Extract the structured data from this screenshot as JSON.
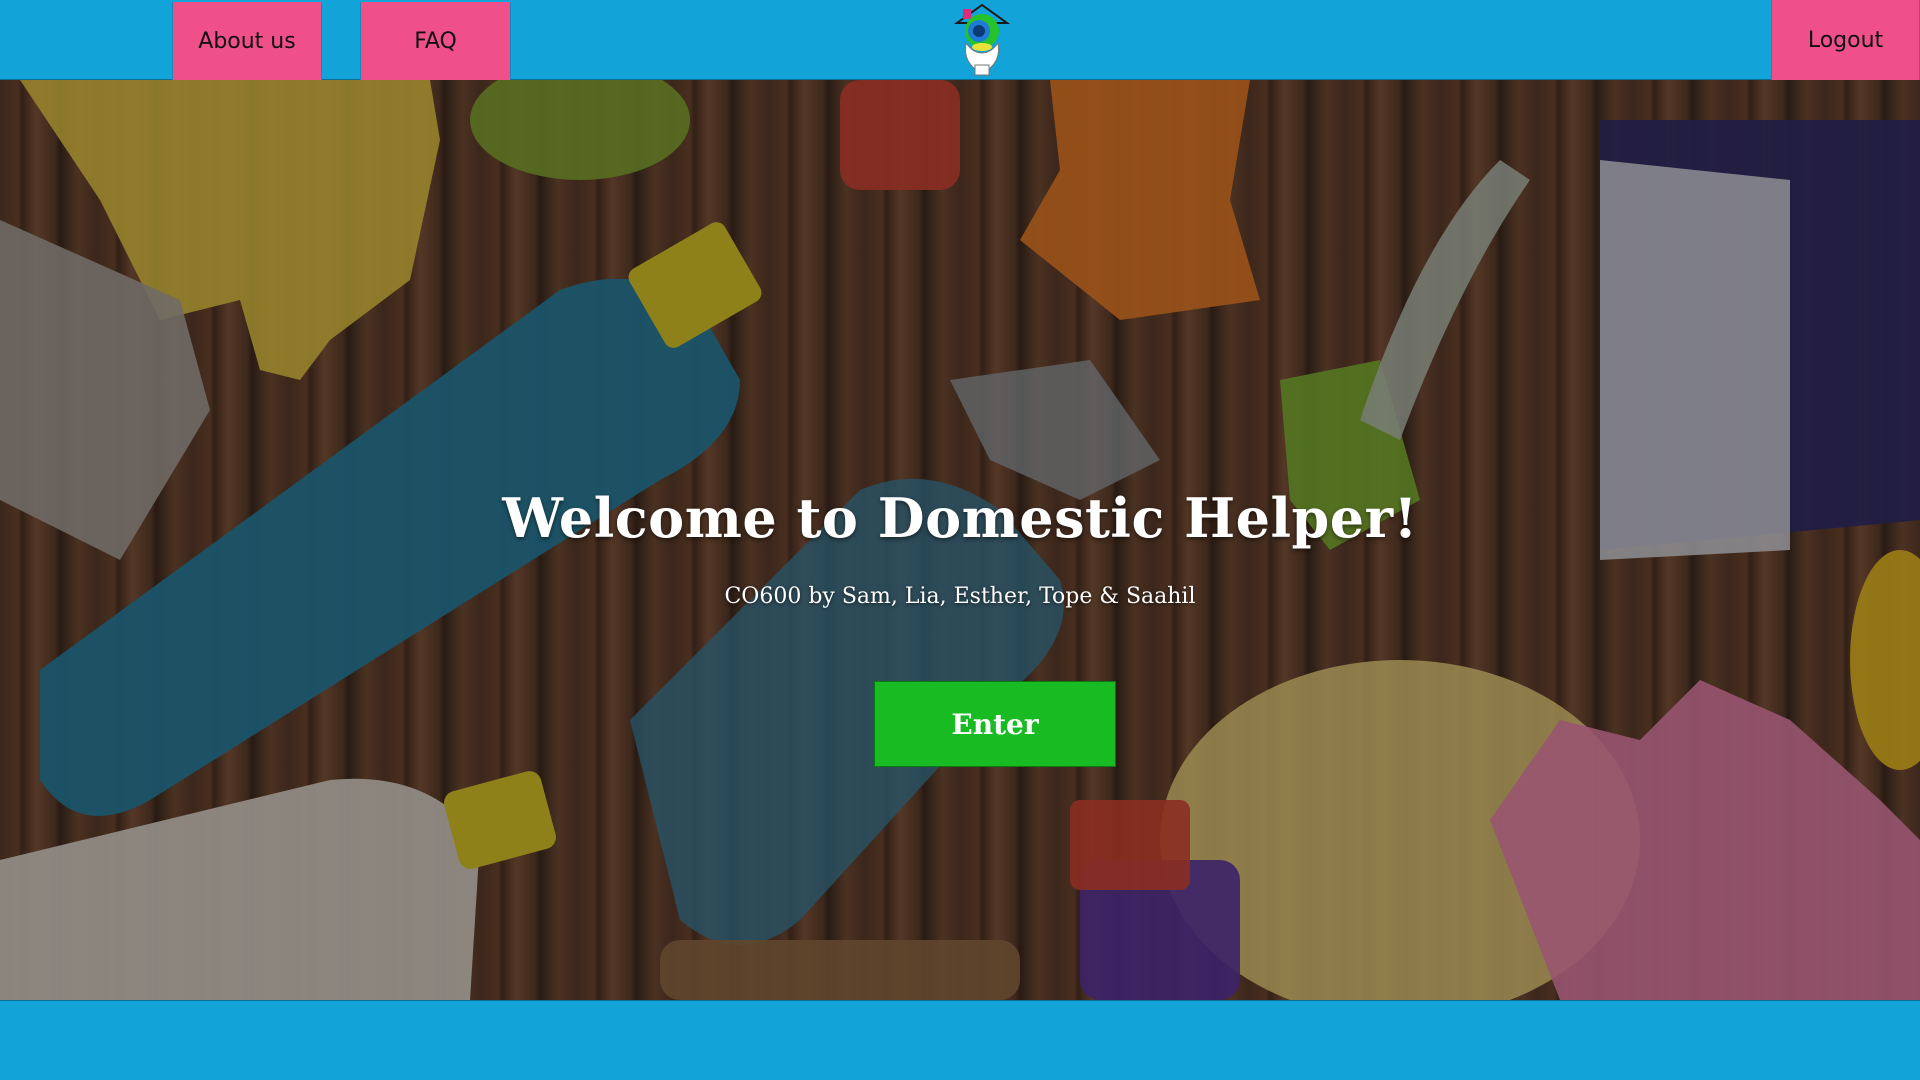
{
  "nav": {
    "about_label": "About us",
    "faq_label": "FAQ",
    "logout_label": "Logout"
  },
  "hero": {
    "title": "Welcome to Domestic Helper!",
    "subtitle": "CO600 by Sam, Lia, Esther, Tope & Saahil",
    "enter_label": "Enter"
  },
  "icons": {
    "logo": "house-hands-logo"
  },
  "colors": {
    "bar": "#12a3d8",
    "nav_button": "#f0508a",
    "enter_button": "#18bb22"
  }
}
